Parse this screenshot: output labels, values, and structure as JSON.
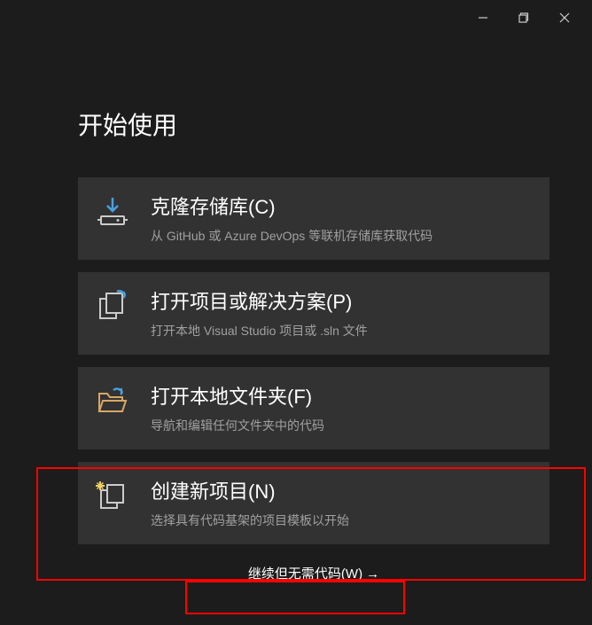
{
  "section": {
    "title": "开始使用"
  },
  "options": {
    "clone": {
      "title": "克隆存储库(C)",
      "desc": "从 GitHub 或 Azure DevOps 等联机存储库获取代码"
    },
    "open_project": {
      "title": "打开项目或解决方案(P)",
      "desc": "打开本地 Visual Studio 项目或 .sln 文件"
    },
    "open_folder": {
      "title": "打开本地文件夹(F)",
      "desc": "导航和编辑任何文件夹中的代码"
    },
    "create_new": {
      "title": "创建新项目(N)",
      "desc": "选择具有代码基架的项目模板以开始"
    }
  },
  "continue": {
    "label": "继续但无需代码(W)",
    "arrow": "→"
  }
}
